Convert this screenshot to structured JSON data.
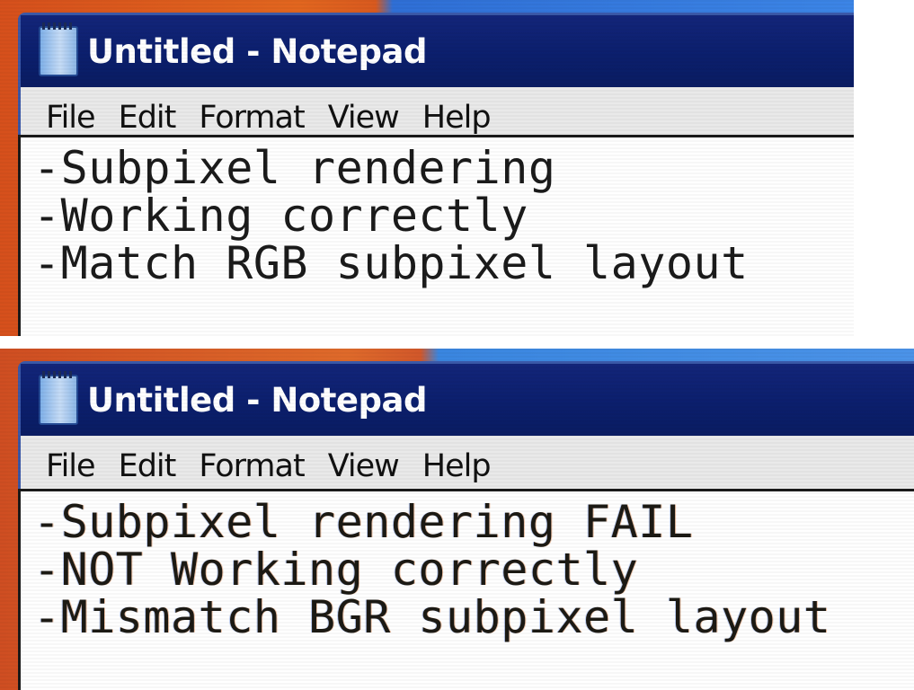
{
  "panels": [
    {
      "window": {
        "title": "Untitled - Notepad",
        "icon": "notepad-icon"
      },
      "menu": [
        "File",
        "Edit",
        "Format",
        "View",
        "Help"
      ],
      "editor": {
        "lines": [
          "-Subpixel rendering",
          "-Working correctly",
          "-Match RGB subpixel layout"
        ]
      }
    },
    {
      "window": {
        "title": "Untitled - Notepad",
        "icon": "notepad-icon"
      },
      "menu": [
        "File",
        "Edit",
        "Format",
        "View",
        "Help"
      ],
      "editor": {
        "lines": [
          "-Subpixel rendering FAIL",
          "-NOT Working correctly",
          "-Mismatch BGR subpixel layout"
        ]
      }
    }
  ],
  "colors": {
    "titlebar": "#0b1f6d",
    "menubar": "#e9e9e9",
    "editor_bg": "#ffffff",
    "desktop_left": "#d6501c",
    "desktop_right": "#3c85e6"
  }
}
